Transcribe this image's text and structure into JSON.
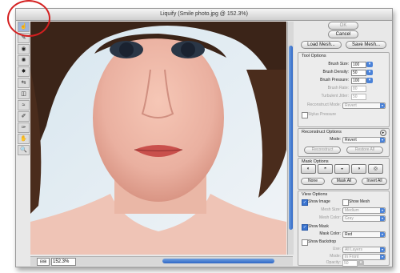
{
  "window": {
    "title": "Liquify (Smile photo.jpg @ 152.3%)"
  },
  "toolbar": {
    "tools": [
      {
        "name": "forward-warp-tool",
        "glyph": "☝",
        "selected": true
      },
      {
        "name": "reconstruct-tool",
        "glyph": "✎"
      },
      {
        "name": "twirl-tool",
        "glyph": "◉"
      },
      {
        "name": "pucker-tool",
        "glyph": "✺"
      },
      {
        "name": "bloat-tool",
        "glyph": "✸"
      },
      {
        "name": "push-left-tool",
        "glyph": "⇆"
      },
      {
        "name": "mirror-tool",
        "glyph": "◫"
      },
      {
        "name": "turbulence-tool",
        "glyph": "≈"
      },
      {
        "name": "freeze-mask-tool",
        "glyph": "✐"
      },
      {
        "name": "thaw-mask-tool",
        "glyph": "✑"
      },
      {
        "name": "hand-tool",
        "glyph": "✋"
      },
      {
        "name": "zoom-tool",
        "glyph": "🔍"
      }
    ]
  },
  "statusbar": {
    "zoom_toggle": "⊟⊞",
    "zoom_value": "152.3%"
  },
  "buttons": {
    "ok": "OK",
    "cancel": "Cancel",
    "load_mesh": "Load Mesh...",
    "save_mesh": "Save Mesh..."
  },
  "tool_options": {
    "title": "Tool Options",
    "brush_size_label": "Brush Size:",
    "brush_size": "100",
    "brush_density_label": "Brush Density:",
    "brush_density": "50",
    "brush_pressure_label": "Brush Pressure:",
    "brush_pressure": "100",
    "brush_rate_label": "Brush Rate:",
    "brush_rate": "80",
    "turbulent_jitter_label": "Turbulent Jitter:",
    "turbulent_jitter": "50",
    "reconstruct_mode_label": "Reconstruct Mode:",
    "reconstruct_mode": "Revert",
    "stylus_pressure_label": "Stylus Pressure"
  },
  "reconstruct_options": {
    "title": "Reconstruct Options",
    "mode_label": "Mode:",
    "mode": "Revert",
    "reconstruct_button": "Reconstruct",
    "restore_all_button": "Restore All"
  },
  "mask_options": {
    "title": "Mask Options",
    "none_button": "None",
    "mask_all_button": "Mask All",
    "invert_all_button": "Invert All"
  },
  "view_options": {
    "title": "View Options",
    "show_image_label": "Show Image",
    "show_mesh_label": "Show Mesh",
    "mesh_size_label": "Mesh Size:",
    "mesh_size": "Medium",
    "mesh_color_label": "Mesh Color:",
    "mesh_color": "Gray",
    "show_mask_label": "Show Mask",
    "mask_color_label": "Mask Color:",
    "mask_color": "Red",
    "show_backdrop_label": "Show Backdrop",
    "use_label": "Use:",
    "use_value": "All Layers",
    "mode_label": "Mode:",
    "mode_value": "In Front",
    "opacity_label": "Opacity:",
    "opacity_value": "50"
  },
  "colors": {
    "accent": "#3a74d0",
    "highlight_circle": "#d42020"
  }
}
